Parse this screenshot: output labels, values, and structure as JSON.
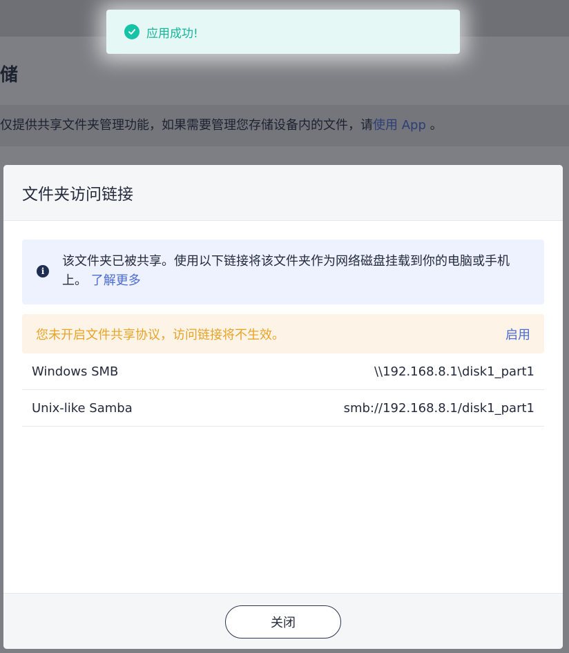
{
  "background": {
    "title_fragment": "储",
    "notice_text": "仅提供共享文件夹管理功能，如果需要管理您存储设备内的文件，请",
    "notice_link": "使用 App",
    "notice_suffix": " 。"
  },
  "toast": {
    "icon": "check-circle-icon",
    "message": "应用成功!"
  },
  "modal": {
    "title": "文件夹访问链接",
    "info": {
      "icon": "info-circle-icon",
      "text": "该文件夹已被共享。使用以下链接将该文件夹作为网络磁盘挂载到你的电脑或手机上。",
      "link": "了解更多"
    },
    "warning": {
      "text": "您未开启文件共享协议，访问链接将不生效。",
      "action": "启用"
    },
    "links": [
      {
        "name": "Windows SMB",
        "value": "\\\\192.168.8.1\\disk1_part1"
      },
      {
        "name": "Unix-like Samba",
        "value": "smb://192.168.8.1/disk1_part1"
      }
    ],
    "close_label": "关闭"
  },
  "colors": {
    "accent": "#4b6ccf",
    "success": "#16c3a6",
    "warning": "#e9a326"
  }
}
